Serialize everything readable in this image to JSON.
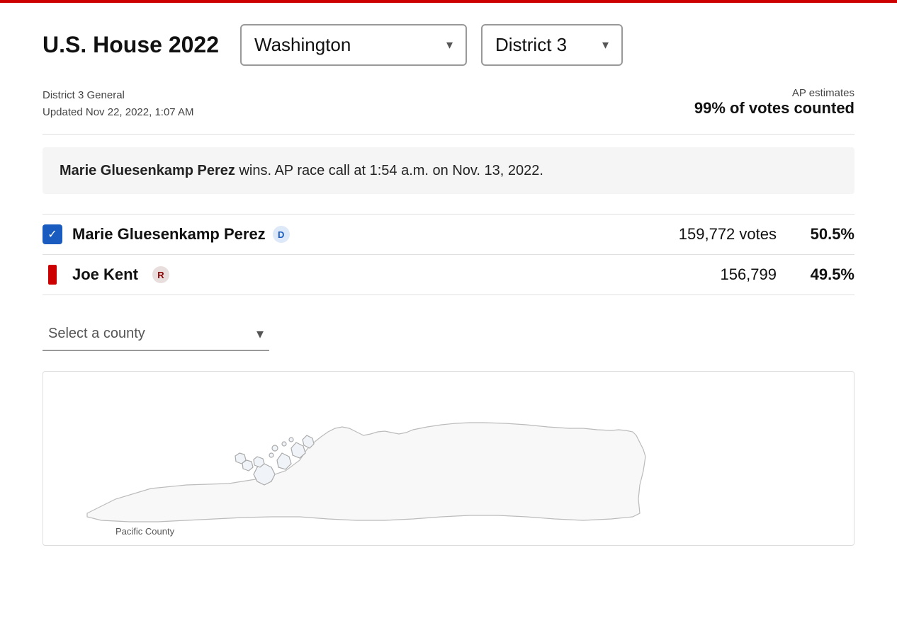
{
  "topBorder": true,
  "header": {
    "title": "U.S. House 2022",
    "stateDropdown": {
      "value": "Washington",
      "chevron": "▾"
    },
    "districtDropdown": {
      "value": "District 3",
      "chevron": "▾"
    }
  },
  "meta": {
    "raceTitle": "District 3 General",
    "updated": "Updated Nov 22, 2022, 1:07 AM",
    "apLabel": "AP estimates",
    "votesCounted": "99% of votes counted"
  },
  "racecall": {
    "winnerName": "Marie Gluesenkamp Perez",
    "callText": " wins. AP race call at 1:54 a.m. on Nov. 13, 2022."
  },
  "candidates": [
    {
      "name": "Marie Gluesenkamp Perez",
      "party": "D",
      "type": "winner",
      "votes": "159,772 votes",
      "pct": "50.5%"
    },
    {
      "name": "Joe Kent",
      "party": "R",
      "type": "loser",
      "votes": "156,799",
      "pct": "49.5%"
    }
  ],
  "countySelector": {
    "placeholder": "Select a county",
    "chevron": "▾"
  },
  "map": {
    "pacificCountyLabel": "Pacific County"
  },
  "icons": {
    "checkmark": "✓",
    "chevronDown": "▾"
  }
}
